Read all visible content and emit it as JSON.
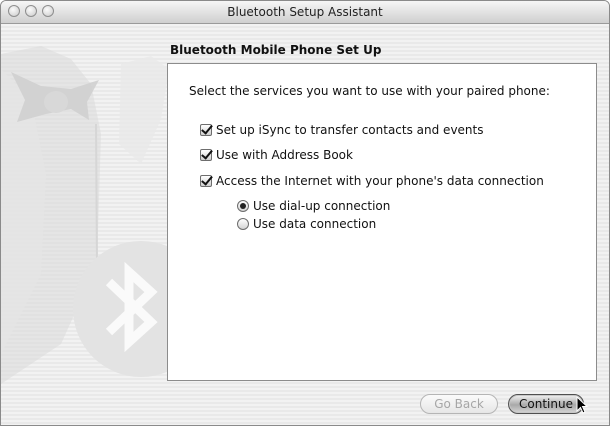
{
  "window": {
    "title": "Bluetooth Setup Assistant"
  },
  "page": {
    "heading": "Bluetooth Mobile Phone Set Up",
    "prompt": "Select the services you want to use with your paired phone:"
  },
  "options": {
    "isync": {
      "label": "Set up iSync to transfer contacts and events",
      "checked": true
    },
    "address_book": {
      "label": "Use with Address Book",
      "checked": true
    },
    "internet": {
      "label": "Access the Internet with your phone's data connection",
      "checked": true
    }
  },
  "connection": {
    "dialup": {
      "label": "Use dial-up connection",
      "selected": true
    },
    "data": {
      "label": "Use data connection",
      "selected": false
    }
  },
  "buttons": {
    "back": "Go Back",
    "continue": "Continue"
  },
  "icons": [
    "close-icon",
    "minimize-icon",
    "zoom-icon",
    "bluetooth-icon",
    "pointer-cursor-icon"
  ]
}
